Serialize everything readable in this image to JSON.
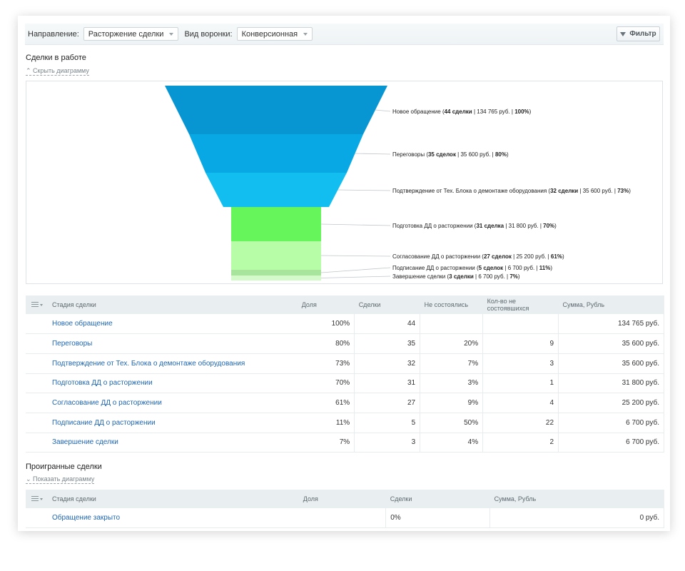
{
  "toolbar": {
    "direction_label": "Направление:",
    "direction_value": "Расторжение сделки",
    "funnel_label": "Вид воронки:",
    "funnel_value": "Конверсионная",
    "filter_label": "Фильтр"
  },
  "active": {
    "title": "Сделки в работе",
    "toggle": "Скрыть диаграмму"
  },
  "chart_data": {
    "type": "funnel",
    "stages": [
      {
        "name": "Новое обращение",
        "count_text": "44 сделки",
        "sum_text": "134 765 руб.",
        "percent_text": "100%",
        "percent": 100,
        "color": "#0896d3"
      },
      {
        "name": "Переговоры",
        "count_text": "35 сделок",
        "sum_text": "35 600 руб.",
        "percent_text": "80%",
        "percent": 80,
        "color": "#07a8e3"
      },
      {
        "name": "Подтверждение от Тех. Блока о демонтаже оборудования",
        "count_text": "32 сделки",
        "sum_text": "35 600 руб.",
        "percent_text": "73%",
        "percent": 73,
        "color": "#12bdf0"
      },
      {
        "name": "Подготовка ДД о расторжении",
        "count_text": "31 сделка",
        "sum_text": "31 800 руб.",
        "percent_text": "70%",
        "percent": 70,
        "color": "#66f55a"
      },
      {
        "name": "Согласование ДД о расторжении",
        "count_text": "27 сделок",
        "sum_text": "25 200 руб.",
        "percent_text": "61%",
        "percent": 61,
        "color": "#b7fca6"
      },
      {
        "name": "Подписание ДД о расторжении",
        "count_text": "5 сделок",
        "sum_text": "6 700 руб.",
        "percent_text": "11%",
        "percent": 11,
        "color": "#a9e49d"
      },
      {
        "name": "Завершение сделки",
        "count_text": "3 сделки",
        "sum_text": "6 700 руб.",
        "percent_text": "7%",
        "percent": 7,
        "color": "#d4fac9"
      }
    ]
  },
  "active_table": {
    "headers": [
      "Стадия сделки",
      "Доля",
      "Сделки",
      "Не состоялись",
      "Кол-во не состоявшихся",
      "Сумма, Рубль"
    ],
    "rows": [
      {
        "stage": "Новое обращение",
        "share": "100%",
        "deals": "44",
        "failed_pct": "",
        "failed_count": "",
        "sum": "134 765 руб."
      },
      {
        "stage": "Переговоры",
        "share": "80%",
        "deals": "35",
        "failed_pct": "20%",
        "failed_count": "9",
        "sum": "35 600 руб."
      },
      {
        "stage": "Подтверждение от Тех. Блока о демонтаже оборудования",
        "share": "73%",
        "deals": "32",
        "failed_pct": "7%",
        "failed_count": "3",
        "sum": "35 600 руб."
      },
      {
        "stage": "Подготовка ДД о расторжении",
        "share": "70%",
        "deals": "31",
        "failed_pct": "3%",
        "failed_count": "1",
        "sum": "31 800 руб."
      },
      {
        "stage": "Согласование ДД о расторжении",
        "share": "61%",
        "deals": "27",
        "failed_pct": "9%",
        "failed_count": "4",
        "sum": "25 200 руб."
      },
      {
        "stage": "Подписание ДД о расторжении",
        "share": "11%",
        "deals": "5",
        "failed_pct": "50%",
        "failed_count": "22",
        "sum": "6 700 руб."
      },
      {
        "stage": "Завершение сделки",
        "share": "7%",
        "deals": "3",
        "failed_pct": "4%",
        "failed_count": "2",
        "sum": "6 700 руб."
      }
    ]
  },
  "lost": {
    "title": "Проигранные сделки",
    "toggle": "Показать диаграмму"
  },
  "lost_table": {
    "headers": [
      "Стадия сделки",
      "Доля",
      "Сделки",
      "Сумма, Рубль"
    ],
    "rows": [
      {
        "stage": "Обращение закрыто",
        "share": "",
        "deals": "0%",
        "sum": "0 руб."
      }
    ]
  }
}
